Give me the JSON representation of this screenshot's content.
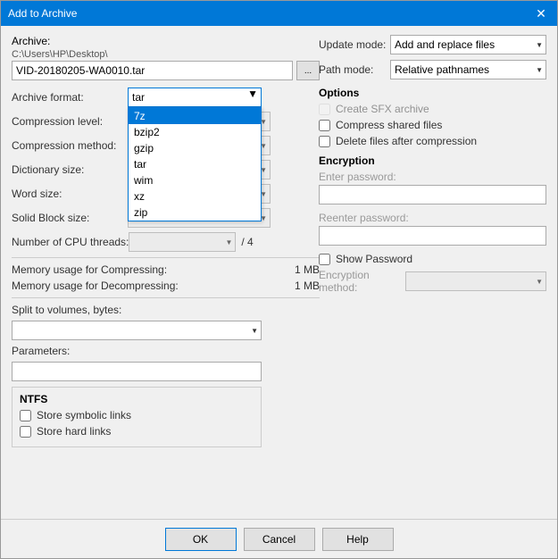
{
  "titleBar": {
    "title": "Add to Archive",
    "closeLabel": "✕"
  },
  "archive": {
    "label": "Archive:",
    "pathLine1": "C:\\Users\\HP\\Desktop\\",
    "pathValue": "VID-20180205-WA0010.tar",
    "browseLabel": "..."
  },
  "format": {
    "label": "Archive format:",
    "selected": "tar",
    "options": [
      "7z",
      "bzip2",
      "gzip",
      "tar",
      "wim",
      "xz",
      "zip"
    ]
  },
  "compression": {
    "label": "Compression level:",
    "value": ""
  },
  "method": {
    "label": "Compression method:",
    "value": ""
  },
  "dictionary": {
    "label": "Dictionary size:",
    "value": ""
  },
  "wordSize": {
    "label": "Word size:",
    "value": ""
  },
  "solidBlock": {
    "label": "Solid Block size:",
    "value": ""
  },
  "cpuThreads": {
    "label": "Number of CPU threads:",
    "value": "",
    "count": "/ 4"
  },
  "memory": {
    "compressingLabel": "Memory usage for Compressing:",
    "compressingValue": "1 MB",
    "decompressingLabel": "Memory usage for Decompressing:",
    "decompressingValue": "1 MB"
  },
  "split": {
    "label": "Split to volumes, bytes:",
    "value": ""
  },
  "parameters": {
    "label": "Parameters:",
    "value": ""
  },
  "ntfs": {
    "title": "NTFS",
    "symbolicLinks": "Store symbolic links",
    "hardLinks": "Store hard links"
  },
  "rightPanel": {
    "updateMode": {
      "label": "Update mode:",
      "value": "Add and replace files"
    },
    "pathMode": {
      "label": "Path mode:",
      "value": "Relative pathnames"
    },
    "options": {
      "title": "Options",
      "createSFX": "Create SFX archive",
      "compressShared": "Compress shared files",
      "deleteAfter": "Delete files after compression"
    },
    "encryption": {
      "title": "Encryption",
      "passwordPlaceholder": "Enter password:",
      "reenterPlaceholder": "Reenter password:",
      "showPassword": "Show Password",
      "methodLabel": "Encryption method:"
    }
  },
  "footer": {
    "ok": "OK",
    "cancel": "Cancel",
    "help": "Help"
  }
}
